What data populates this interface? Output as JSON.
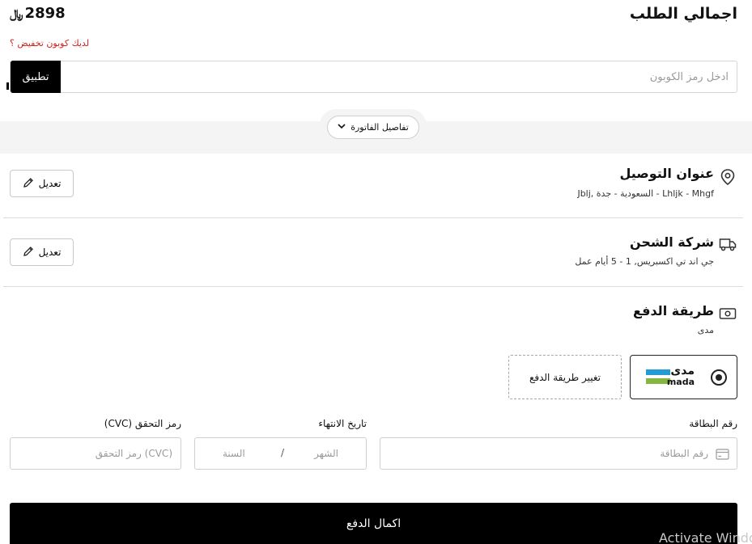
{
  "summary": {
    "title": "اجمالي الطلب",
    "amount": "2898",
    "currency_symbol": "﷼",
    "coupon_question": "لديك كوبون تخفيض ؟"
  },
  "coupon": {
    "placeholder": "ادخل رمز الكوبون",
    "apply_label": "تطبيق"
  },
  "invoice": {
    "toggle_label": "تفاصيل الفاتورة"
  },
  "delivery": {
    "title": "عنوان التوصيل",
    "subtitle": "Lhljk - Mhgf - السعودية - جدة ,Jblj",
    "edit_label": "تعديل"
  },
  "shipping": {
    "title": "شركة الشحن",
    "subtitle": "جي اند تي اكسبريس, 1 - 5 أيام عمل",
    "edit_label": "تعديل"
  },
  "payment": {
    "title": "طريقة الدفع",
    "subtitle": "مدى",
    "selected_method": {
      "logo_ar": "مدى",
      "logo_en": "mada",
      "selected": true
    },
    "change_label": "تغيير طريقة الدفع"
  },
  "card_form": {
    "card_number_label": "رقم البطاقة",
    "card_number_placeholder": "رقم البطاقة",
    "expiry_label": "تاريخ الانتهاء",
    "expiry_month_placeholder": "الشهر",
    "expiry_separator": "/",
    "expiry_year_placeholder": "السنة",
    "cvc_label": "رمز التحقق (CVC)",
    "cvc_placeholder": "(CVC) رمز التحقق"
  },
  "submit": {
    "label": "اكمال الدفع"
  },
  "os_overlay": {
    "watermark": "Activate Windows"
  },
  "colors": {
    "accent": "#000000",
    "error_text": "#d0231f",
    "mada_blue": "#259bd6",
    "mada_green": "#84b740",
    "band_gray": "#f4f4f4"
  }
}
